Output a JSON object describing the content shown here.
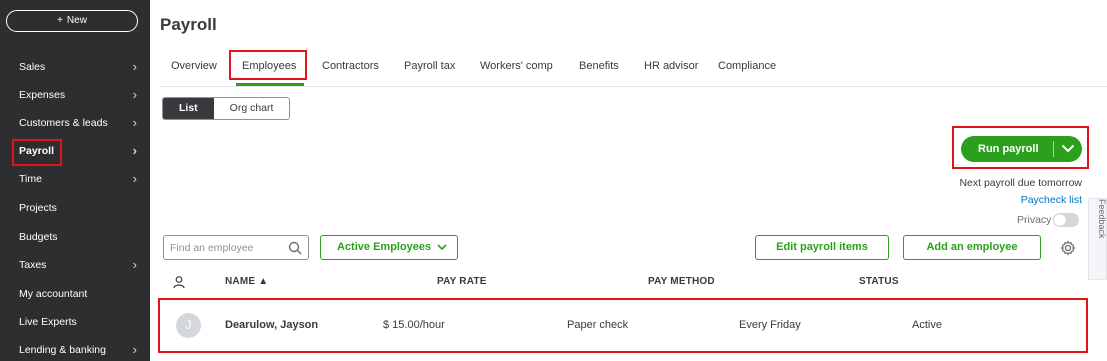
{
  "sidebar": {
    "new_label": "New",
    "items": [
      {
        "label": "Sales",
        "has_chevron": true
      },
      {
        "label": "Expenses",
        "has_chevron": true
      },
      {
        "label": "Customers & leads",
        "has_chevron": true
      },
      {
        "label": "Payroll",
        "has_chevron": true,
        "active": true
      },
      {
        "label": "Time",
        "has_chevron": true
      },
      {
        "label": "Projects",
        "has_chevron": false
      },
      {
        "label": "Budgets",
        "has_chevron": false
      },
      {
        "label": "Taxes",
        "has_chevron": true
      },
      {
        "label": "My accountant",
        "has_chevron": false
      },
      {
        "label": "Live Experts",
        "has_chevron": false
      },
      {
        "label": "Lending & banking",
        "has_chevron": true
      }
    ]
  },
  "page": {
    "title": "Payroll"
  },
  "tabs": [
    {
      "label": "Overview"
    },
    {
      "label": "Employees",
      "active": true
    },
    {
      "label": "Contractors"
    },
    {
      "label": "Payroll tax"
    },
    {
      "label": "Workers' comp"
    },
    {
      "label": "Benefits"
    },
    {
      "label": "HR advisor"
    },
    {
      "label": "Compliance"
    }
  ],
  "view_toggle": {
    "list": "List",
    "org_chart": "Org chart",
    "selected": "List"
  },
  "run_payroll": {
    "label": "Run payroll"
  },
  "next_payroll": "Next payroll due tomorrow",
  "paycheck_list": "Paycheck list",
  "privacy": "Privacy",
  "feedback": "Feedback",
  "search": {
    "placeholder": "Find an employee"
  },
  "filter": {
    "label": "Active Employees"
  },
  "buttons": {
    "edit_payroll_items": "Edit payroll items",
    "add_employee": "Add an employee"
  },
  "table": {
    "headers": {
      "name": "NAME ▲",
      "pay_rate": "PAY RATE",
      "pay_method": "PAY METHOD",
      "status": "STATUS"
    },
    "rows": [
      {
        "initial": "J",
        "name": "Dearulow, Jayson",
        "pay_rate": "$ 15.00/hour",
        "pay_method": "Paper check",
        "schedule": "Every Friday",
        "status": "Active"
      }
    ]
  },
  "colors": {
    "sidebar_bg": "#2d2e30",
    "accent_green": "#2ca01c",
    "link_blue": "#0077c5",
    "highlight_red": "#e0151c"
  }
}
